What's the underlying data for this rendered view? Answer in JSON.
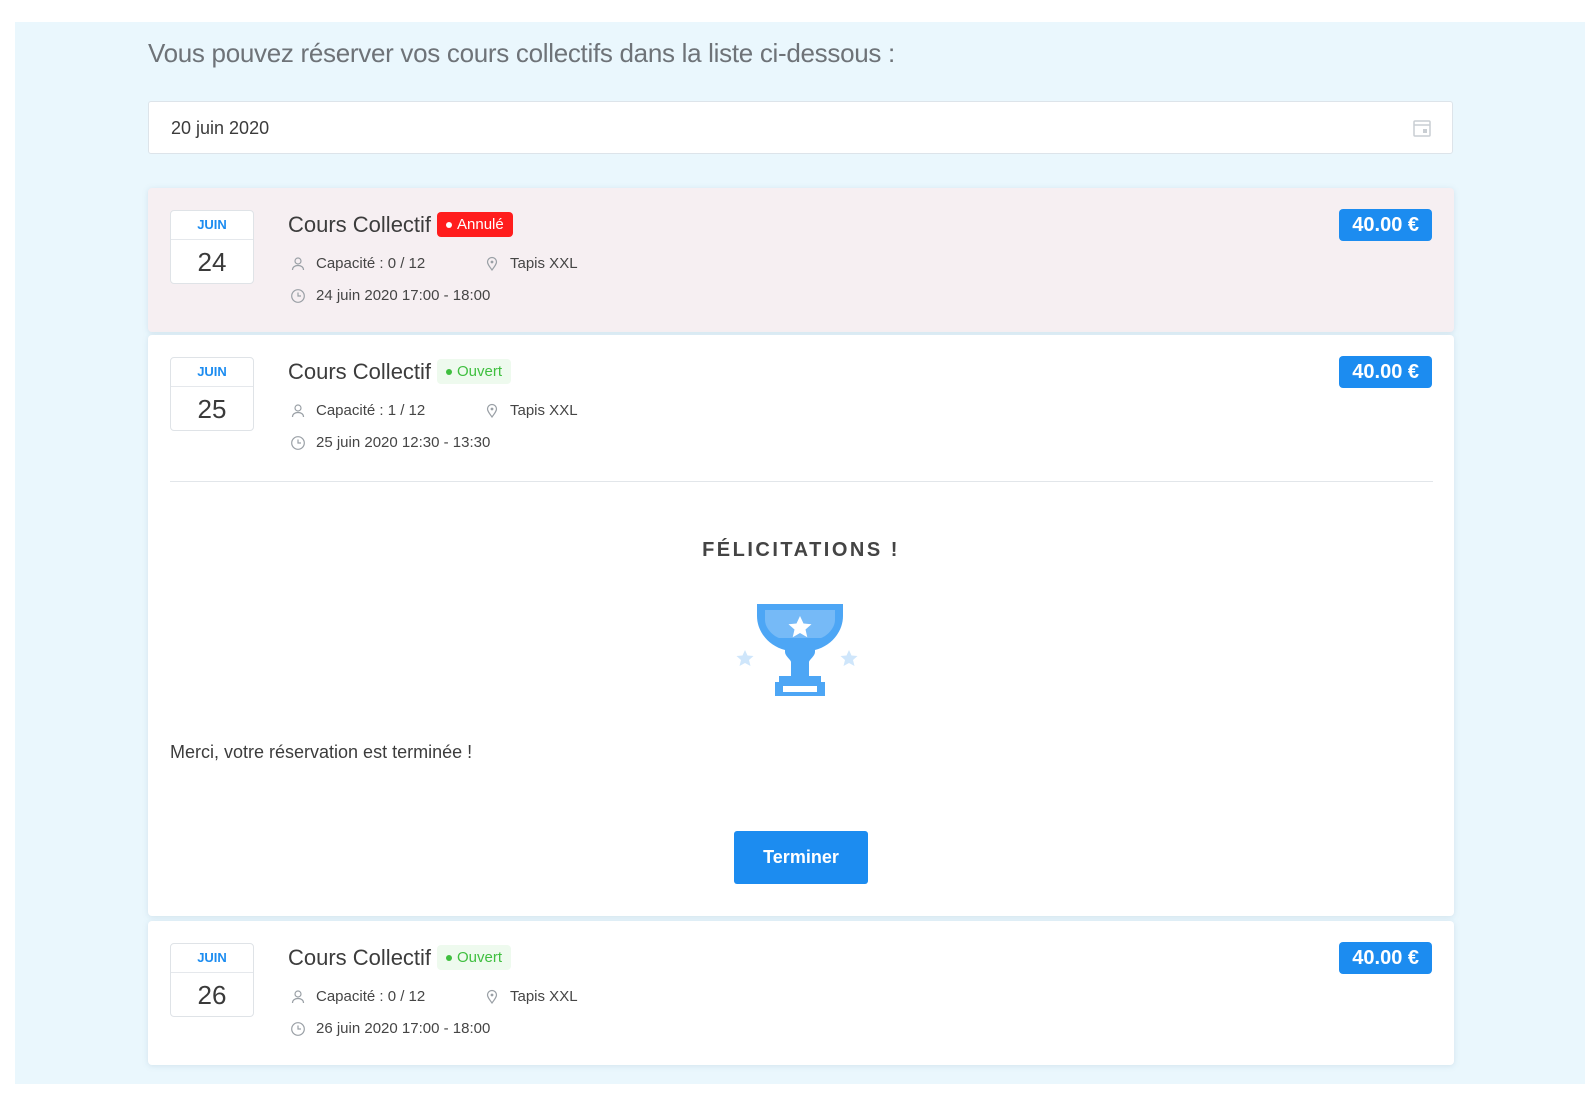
{
  "intro_text": "Vous pouvez réserver vos cours collectifs dans la liste ci-dessous :",
  "date_picker": {
    "value": "20 juin 2020",
    "icon": "calendar-icon"
  },
  "courses": [
    {
      "month": "JUIN",
      "day": "24",
      "title": "Cours Collectif",
      "status": "Annulé",
      "status_color": "#ff1d1d",
      "price": "40.00 €",
      "capacity": "Capacité : 0 / 12",
      "location": "Tapis XXL",
      "time": "24 juin 2020 17:00 - 18:00"
    },
    {
      "month": "JUIN",
      "day": "25",
      "title": "Cours Collectif",
      "status": "Ouvert",
      "status_color": "#3fbf3f",
      "price": "40.00 €",
      "capacity": "Capacité : 1 / 12",
      "location": "Tapis XXL",
      "time": "25 juin 2020 12:30 - 13:30"
    },
    {
      "month": "JUIN",
      "day": "26",
      "title": "Cours Collectif",
      "status": "Ouvert",
      "status_color": "#3fbf3f",
      "price": "40.00 €",
      "capacity": "Capacité : 0 / 12",
      "location": "Tapis XXL",
      "time": "26 juin 2020 17:00 - 18:00"
    }
  ],
  "confirmation": {
    "heading": "FÉLICITATIONS !",
    "icon": "trophy-icon",
    "message": "Merci, votre réservation est terminée !",
    "button_label": "Terminer"
  },
  "colors": {
    "accent": "#1c8cf0",
    "cancelled": "#ff1d1d",
    "open": "#3fbf3f",
    "background": "#eaf7fd"
  }
}
